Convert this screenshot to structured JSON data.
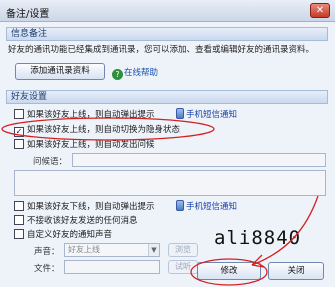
{
  "window": {
    "title": "备注/设置",
    "close_glyph": "✕"
  },
  "info_section": {
    "title": "信息备注",
    "description": "好友的通讯功能已经集成到通讯录，您可以添加、查看或编辑好友的通讯录资料。",
    "add_button": "添加通讯录资料",
    "help_link": "在线帮助",
    "help_icon_glyph": "?"
  },
  "friend_section": {
    "title": "好友设置",
    "options": [
      {
        "label": "如果该好友上线，则自动弹出提示",
        "checked": false
      },
      {
        "label": "如果该好友上线，则自动切换为隐身状态",
        "checked": true
      },
      {
        "label": "如果该好友上线，则自动发出问候",
        "checked": false
      },
      {
        "label": "如果该好友下线，则自动弹出提示",
        "checked": false
      },
      {
        "label": "不接收该好友发送的任何消息",
        "checked": false
      },
      {
        "label": "自定义好友的通知声音",
        "checked": false
      }
    ],
    "check_mark": "✓",
    "sms_notify_1": "手机短信通知",
    "sms_notify_2": "手机短信通知",
    "greeting_label": "问候语：",
    "sound_label": "声音：",
    "sound_value": "好友上线",
    "browse_label": "浏览",
    "file_label": "文件：",
    "play_label": "试听"
  },
  "watermark": "ali8840",
  "buttons": {
    "ok": "修改",
    "close": "关闭"
  },
  "annotations": {
    "color": "#d42020"
  }
}
